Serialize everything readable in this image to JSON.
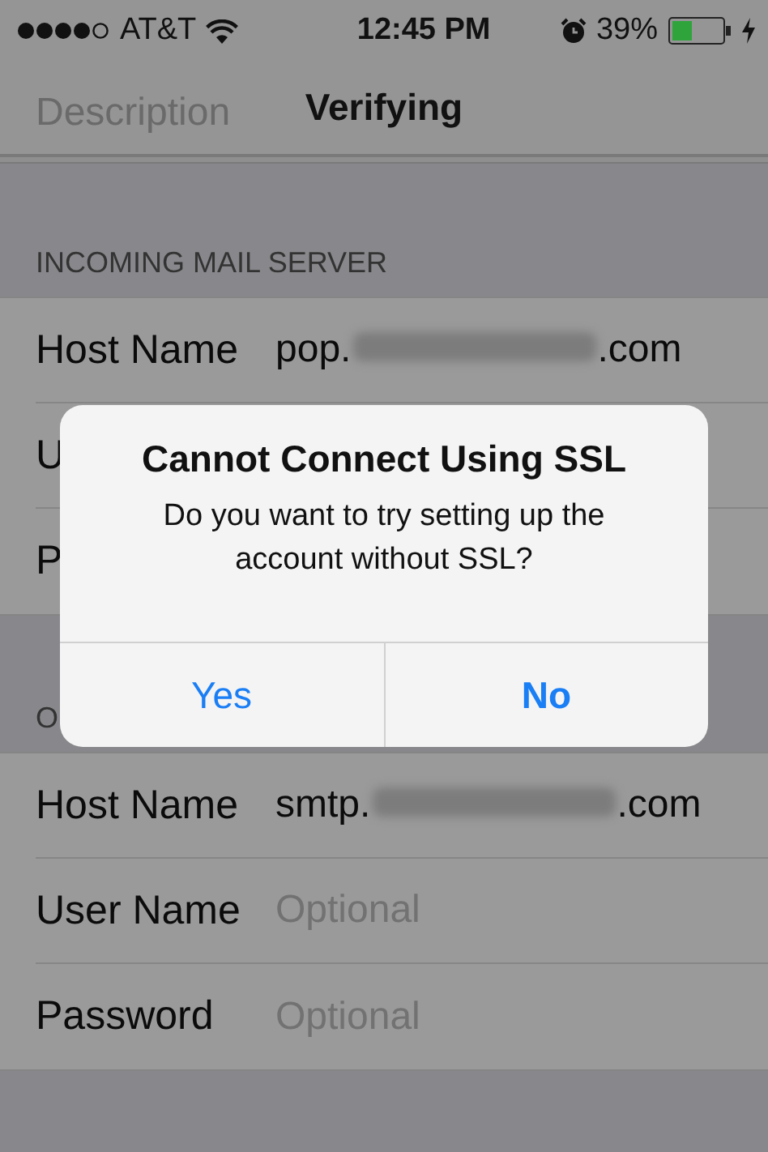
{
  "status_bar": {
    "carrier": "AT&T",
    "time": "12:45 PM",
    "battery": "39%"
  },
  "nav": {
    "title": "Verifying",
    "ghost_label": "Description"
  },
  "sections": [
    {
      "header": "INCOMING MAIL SERVER",
      "rows": [
        {
          "label": "Host Name",
          "kind": "redacted",
          "prefix": "pop.",
          "suffix": ".com"
        },
        {
          "label": "U",
          "kind": "covered"
        },
        {
          "label": "P",
          "kind": "covered"
        }
      ]
    },
    {
      "header": "O",
      "rows": [
        {
          "label": "Host Name",
          "kind": "redacted",
          "prefix": "smtp.",
          "suffix": ".com"
        },
        {
          "label": "User Name",
          "kind": "field",
          "placeholder": "Optional"
        },
        {
          "label": "Password",
          "kind": "field",
          "placeholder": "Optional"
        }
      ]
    }
  ],
  "alert": {
    "title": "Cannot Connect Using SSL",
    "message": "Do you want to try setting up the account without SSL?",
    "buttons": [
      {
        "label": "Yes",
        "kind": "normal"
      },
      {
        "label": "No",
        "kind": "preferred"
      }
    ]
  }
}
